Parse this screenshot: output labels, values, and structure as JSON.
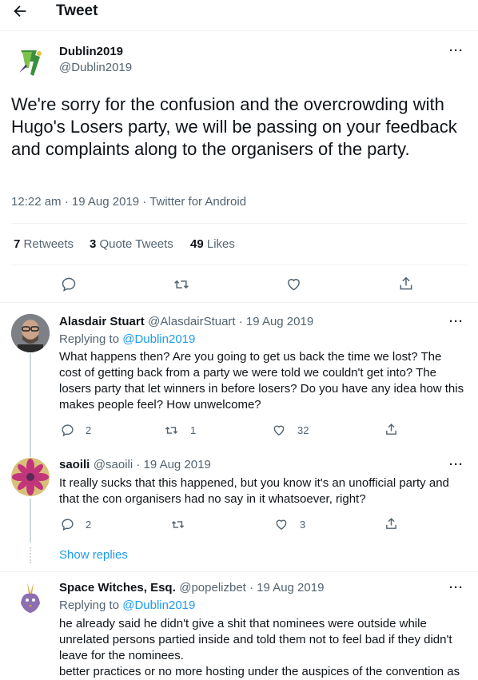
{
  "header": {
    "title": "Tweet"
  },
  "main_tweet": {
    "display_name": "Dublin2019",
    "handle": "@Dublin2019",
    "text": "We're sorry for the confusion and the overcrowding with Hugo's Losers party, we will be passing on your feedback and complaints along to the organisers of the party.",
    "meta": "12:22 am · 19 Aug 2019 · Twitter for Android",
    "stats": {
      "retweets_count": "7",
      "retweets_label": "Retweets",
      "quotes_count": "3",
      "quotes_label": "Quote Tweets",
      "likes_count": "49",
      "likes_label": "Likes"
    }
  },
  "replies": [
    {
      "name": "Alasdair Stuart",
      "handle": "@AlasdairStuart · 19 Aug 2019",
      "replying_prefix": "Replying to",
      "replying_to": "@Dublin2019",
      "text": "What happens then? Are you going to get us back the time we lost? The cost of getting back from a party we were told we couldn't get into? The losers party that let winners in before losers? Do you have any idea how this makes people feel? How unwelcome?",
      "reply_count": "2",
      "retweet_count": "1",
      "like_count": "32"
    },
    {
      "name": "saoili",
      "handle": "@saoili · 19 Aug 2019",
      "text": "It really sucks that this happened, but you know it's an unofficial party and that the con organisers had no say in it whatsoever, right?",
      "reply_count": "2",
      "retweet_count": "",
      "like_count": "3"
    },
    {
      "name": "Space Witches, Esq.",
      "handle": "@popelizbet · 19 Aug 2019",
      "replying_prefix": "Replying to",
      "replying_to": "@Dublin2019",
      "text": "he already said he didn't give a shit that nominees were outside while unrelated persons partied inside and told them not to feel bad if they didn't leave for the nominees.\nbetter practices or no more hosting under the auspices of the convention as"
    }
  ],
  "show_replies": "Show replies",
  "colors": {
    "accent": "#1d9bf0",
    "muted": "#536471",
    "text": "#0f1419",
    "divider": "#eff3f4"
  }
}
